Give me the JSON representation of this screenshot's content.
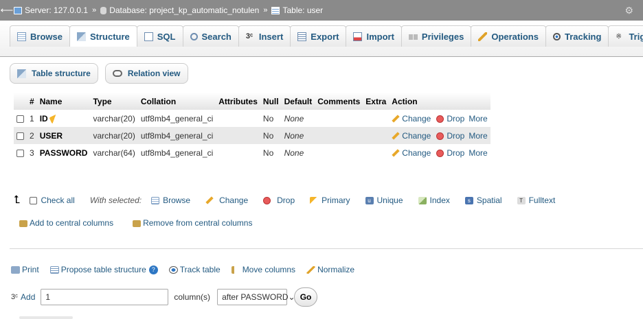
{
  "breadcrumb": {
    "server_label": "Server: 127.0.0.1",
    "database_label": "Database: project_kp_automatic_notulen",
    "table_label": "Table: user",
    "separator": "»"
  },
  "tabs": [
    {
      "label": "Browse",
      "icon": "browse-icon",
      "active": false
    },
    {
      "label": "Structure",
      "icon": "structure-icon",
      "active": true
    },
    {
      "label": "SQL",
      "icon": "sql-icon",
      "active": false
    },
    {
      "label": "Search",
      "icon": "search-icon",
      "active": false
    },
    {
      "label": "Insert",
      "icon": "insert-icon",
      "active": false
    },
    {
      "label": "Export",
      "icon": "export-icon",
      "active": false
    },
    {
      "label": "Import",
      "icon": "import-icon",
      "active": false
    },
    {
      "label": "Privileges",
      "icon": "privileges-icon",
      "active": false
    },
    {
      "label": "Operations",
      "icon": "operations-icon",
      "active": false
    },
    {
      "label": "Tracking",
      "icon": "tracking-icon",
      "active": false
    },
    {
      "label": "Triggers",
      "icon": "triggers-icon",
      "active": false
    }
  ],
  "subtabs": {
    "table_structure": "Table structure",
    "relation_view": "Relation view"
  },
  "table": {
    "headers": {
      "num": "#",
      "name": "Name",
      "type": "Type",
      "collation": "Collation",
      "attributes": "Attributes",
      "null": "Null",
      "default": "Default",
      "comments": "Comments",
      "extra": "Extra",
      "action": "Action"
    },
    "rows": [
      {
        "num": "1",
        "name": "ID",
        "primary": true,
        "type": "varchar(20)",
        "collation": "utf8mb4_general_ci",
        "attributes": "",
        "null": "No",
        "default": "None",
        "comments": "",
        "extra": ""
      },
      {
        "num": "2",
        "name": "USER",
        "primary": false,
        "type": "varchar(20)",
        "collation": "utf8mb4_general_ci",
        "attributes": "",
        "null": "No",
        "default": "None",
        "comments": "",
        "extra": ""
      },
      {
        "num": "3",
        "name": "PASSWORD",
        "primary": false,
        "type": "varchar(64)",
        "collation": "utf8mb4_general_ci",
        "attributes": "",
        "null": "No",
        "default": "None",
        "comments": "",
        "extra": ""
      }
    ],
    "actions": {
      "change": "Change",
      "drop": "Drop",
      "more": "More"
    }
  },
  "bulk": {
    "check_all": "Check all",
    "with_selected": "With selected:",
    "browse": "Browse",
    "change": "Change",
    "drop": "Drop",
    "primary": "Primary",
    "unique": "Unique",
    "index": "Index",
    "spatial": "Spatial",
    "fulltext": "Fulltext"
  },
  "central": {
    "add": "Add to central columns",
    "remove": "Remove from central columns"
  },
  "tools": {
    "print": "Print",
    "propose": "Propose table structure",
    "track": "Track table",
    "move": "Move columns",
    "normalize": "Normalize"
  },
  "add_columns": {
    "label": "Add",
    "count_value": "1",
    "unit": "column(s)",
    "position": "after PASSWORD",
    "go": "Go"
  },
  "colors": {
    "link": "#235a81",
    "topbar": "#8a8a8a",
    "row_alt": "#e9e9e9"
  }
}
